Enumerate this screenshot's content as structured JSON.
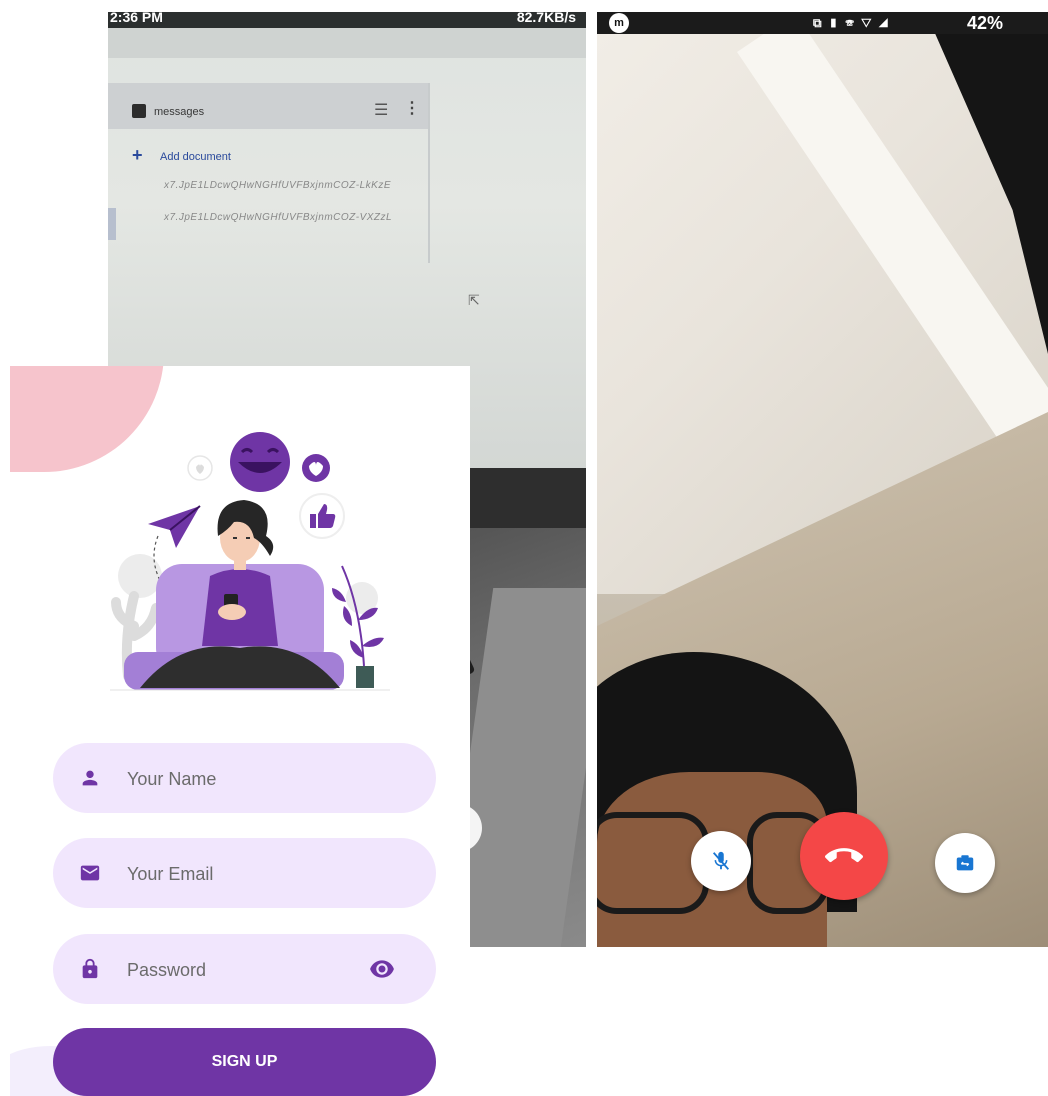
{
  "left_phone": {
    "status": {
      "time": "2:36 PM",
      "stats": "82.7KB/s"
    },
    "console": {
      "collection_name": "messages",
      "add_document_label": "Add document",
      "documents": [
        "x7.JpE1LDcwQHwNGHfUVFBxjnmCOZ-LkKzE",
        "x7.JpE1LDcwQHwNGHfUVFBxjnmCOZ-VXZzL"
      ]
    }
  },
  "right_phone": {
    "status": {
      "app_badge": "m",
      "battery": "42%"
    },
    "controls": {
      "mute_icon": "mic-off-icon",
      "end_icon": "call-end-icon",
      "switch_icon": "switch-camera-icon"
    }
  },
  "signup": {
    "fields": {
      "name_placeholder": "Your Name",
      "email_placeholder": "Your Email",
      "password_placeholder": "Password"
    },
    "button_label": "SIGN UP",
    "icons": {
      "name": "person-icon",
      "email": "mail-icon",
      "password": "lock-icon",
      "visibility": "eye-icon"
    },
    "colors": {
      "primary": "#6f35a5",
      "field_bg": "#f1e6fd",
      "accent_blob": "#f6c4cc",
      "end_call": "#f44747"
    }
  }
}
